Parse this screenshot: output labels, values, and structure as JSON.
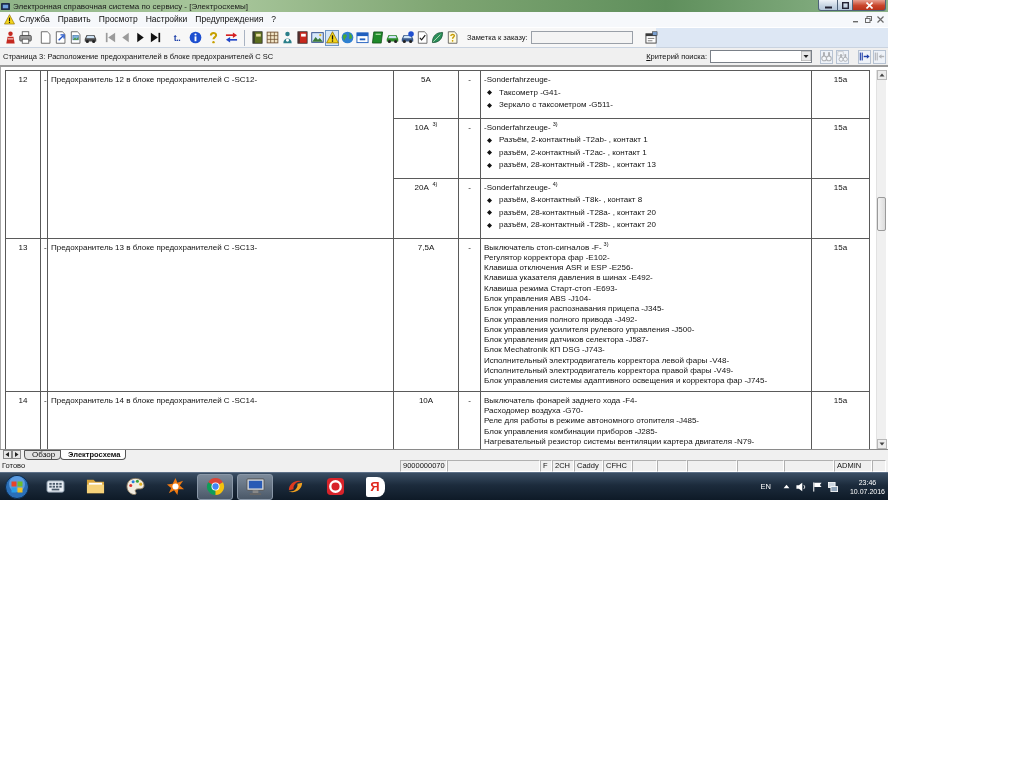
{
  "window": {
    "title": "Электронная справочная система по сервису - [Электросхемы]"
  },
  "menu": [
    {
      "label": "Служба"
    },
    {
      "label": "Править"
    },
    {
      "label": "Просмотр"
    },
    {
      "label": "Настройки"
    },
    {
      "label": "Предупреждения"
    },
    {
      "label": "?"
    }
  ],
  "toolbar": {
    "buttons": [
      {
        "disabled": false,
        "selected": false
      },
      {
        "disabled": false,
        "selected": false
      },
      {
        "disabled": false,
        "selected": false
      },
      {
        "disabled": false,
        "selected": false
      },
      {
        "disabled": false,
        "selected": false
      },
      {
        "disabled": false,
        "selected": false
      },
      {
        "disabled": true,
        "selected": false
      },
      {
        "disabled": true,
        "selected": false
      },
      {
        "disabled": false,
        "selected": false
      },
      {
        "disabled": false,
        "selected": false
      },
      {
        "disabled": false,
        "selected": false,
        "label": "t.."
      },
      {
        "disabled": false,
        "selected": false
      },
      {
        "disabled": false,
        "selected": false
      },
      {
        "disabled": false,
        "selected": false
      },
      {
        "disabled": false,
        "selected": false
      },
      {
        "disabled": false,
        "selected": false
      },
      {
        "disabled": false,
        "selected": false
      },
      {
        "disabled": false,
        "selected": false
      },
      {
        "disabled": false,
        "selected": false
      },
      {
        "disabled": false,
        "selected": true
      },
      {
        "disabled": false,
        "selected": false
      },
      {
        "disabled": false,
        "selected": false
      },
      {
        "disabled": false,
        "selected": false
      },
      {
        "disabled": false,
        "selected": false
      },
      {
        "disabled": false,
        "selected": false
      },
      {
        "disabled": false,
        "selected": false
      },
      {
        "disabled": false,
        "selected": false
      },
      {
        "disabled": false,
        "selected": false
      }
    ],
    "note_label": "Заметка к заказу:"
  },
  "page_header": {
    "title": "Страница 3: Расположение предохранителей в блоке предохранителей C SC",
    "search_label": "Критерий поиска:",
    "search_buttons": [
      {
        "disabled": true
      },
      {
        "disabled": true
      },
      {
        "disabled": false
      },
      {
        "disabled": true
      }
    ]
  },
  "table": {
    "rows": [
      {
        "number": "12",
        "dash": "-",
        "description": "Предохранитель 12 в блоке предохранителей C -SC12-",
        "fuses": [
          {
            "rating": "5A",
            "dash": "-",
            "consumers": [
              {
                "text": "-Sonderfahrzeuge-",
                "bullet": false
              },
              {
                "text": "Таксометр -G41-",
                "bullet": true
              },
              {
                "text": "Зеркало с таксометром -G511-",
                "bullet": true
              }
            ],
            "terminal": "15a"
          },
          {
            "rating": "10A $^{3)}$",
            "dash": "-",
            "consumers": [
              {
                "text": "-Sonderfahrzeuge-$^{3)}$",
                "bullet": false
              },
              {
                "text": "Разъём, 2-контактный -T2ab- , контакт 1",
                "bullet": true
              },
              {
                "text": "разъём, 2-контактный -T2ac- , контакт 1",
                "bullet": true
              },
              {
                "text": "разъём, 28-контактный -T28b- , контакт 13",
                "bullet": true
              }
            ],
            "terminal": "15a"
          },
          {
            "rating": "20A $^{4)}$",
            "dash": "-",
            "consumers": [
              {
                "text": "-Sonderfahrzeuge-$^{4)}$",
                "bullet": false
              },
              {
                "text": "разъём, 8-контактный -T8k- , контакт 8",
                "bullet": true
              },
              {
                "text": "разъём, 28-контактный -T28a- , контакт 20",
                "bullet": true
              },
              {
                "text": "разъём, 28-контактный -T28b- , контакт 20",
                "bullet": true
              }
            ],
            "terminal": "15a"
          }
        ]
      },
      {
        "number": "13",
        "dash": "-",
        "description": "Предохранитель 13 в блоке предохранителей C -SC13-",
        "fuses": [
          {
            "rating": "7,5A",
            "dash": "-",
            "consumers": [
              {
                "text": "Выключатель стоп-сигналов -F-$^{3)}$",
                "bullet": false
              },
              {
                "text": "Регулятор корректора фар -E102-",
                "bullet": false
              },
              {
                "text": "Клавиша отключения ASR и ESP -E256-",
                "bullet": false
              },
              {
                "text": "Клавиша указателя давления в шинах -E492-",
                "bullet": false
              },
              {
                "text": "Клавиша режима Старт-стоп -E693-",
                "bullet": false
              },
              {
                "text": "Блок управления ABS -J104-",
                "bullet": false
              },
              {
                "text": "Блок управления распознавания прицепа -J345-",
                "bullet": false
              },
              {
                "text": "Блок управления полного привода -J492-",
                "bullet": false
              },
              {
                "text": "Блок управления усилителя рулевого управления -J500-",
                "bullet": false
              },
              {
                "text": "Блок управления датчиков селектора -J587-",
                "bullet": false
              },
              {
                "text": "Блок Mechatronik КП DSG -J743-",
                "bullet": false
              },
              {
                "text": "Исполнительный электродвигатель корректора левой фары -V48-",
                "bullet": false
              },
              {
                "text": "Исполнительный электродвигатель корректора правой фары -V49-",
                "bullet": false
              },
              {
                "text": "Блок управления системы адаптивного освещения и корректора фар -J745-",
                "bullet": false
              }
            ],
            "terminal": "15a"
          }
        ]
      },
      {
        "number": "14",
        "dash": "-",
        "description": "Предохранитель 14 в блоке предохранителей C -SC14-",
        "fuses": [
          {
            "rating": "10A",
            "dash": "-",
            "consumers": [
              {
                "text": "Выключатель фонарей заднего хода -F4-",
                "bullet": false
              },
              {
                "text": "Расходомер воздуха -G70-",
                "bullet": false
              },
              {
                "text": "Реле для работы в режиме автономного отопителя -J485-",
                "bullet": false
              },
              {
                "text": "Блок управления комбинации приборов -J285-",
                "bullet": false
              },
              {
                "text": "Нагревательный резистор системы вентиляции картера двигателя -N79-",
                "bullet": false
              }
            ],
            "terminal": "15a"
          }
        ]
      }
    ]
  },
  "tabs": [
    {
      "label": "Обзор",
      "selected": false
    },
    {
      "label": "Электросхема",
      "selected": true
    }
  ],
  "status_bar": {
    "message": "Готово",
    "panels": [
      "9000000070",
      "F",
      "2CH",
      "Caddy",
      "CFHC",
      "ADMIN"
    ]
  },
  "taskbar": {
    "buttons": [
      {
        "open": false
      },
      {
        "open": false
      },
      {
        "open": false
      },
      {
        "open": false
      },
      {
        "open": true
      },
      {
        "open": true
      },
      {
        "open": false
      },
      {
        "open": false
      },
      {
        "open": false,
        "label": "Я"
      }
    ],
    "language": "EN",
    "time": "23:46",
    "date": "10.07.2016"
  }
}
